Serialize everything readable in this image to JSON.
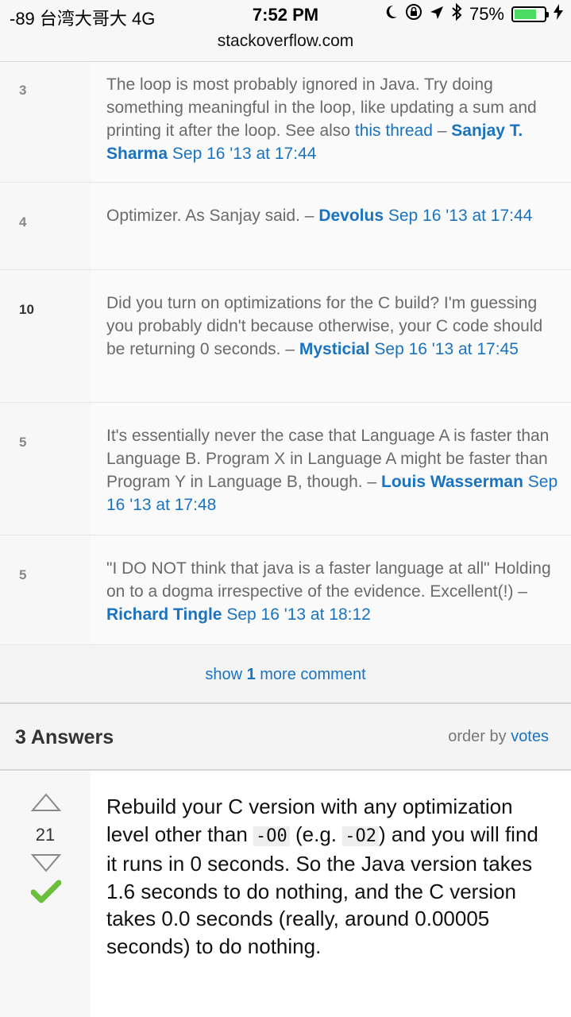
{
  "status_bar": {
    "carrier": "-89 台湾大哥大  4G",
    "time": "7:52 PM",
    "battery": "75%",
    "battery_level": 0.75,
    "icons": [
      "moon-icon",
      "rotation-lock-icon",
      "location-icon",
      "bluetooth-icon",
      "battery-icon",
      "charging-icon"
    ],
    "url": "stackoverflow.com"
  },
  "comments": [
    {
      "score": "3",
      "text": "The loop is most probably ignored in Java. Try doing something meaningful in the loop, like updating a sum and printing it after the loop. See also ",
      "link": "this thread",
      "sep": " – ",
      "user": "Sanjay T. Sharma",
      "date": "Sep 16 '13 at 17:44"
    },
    {
      "score": "4",
      "text": "Optimizer. As Sanjay said.",
      "sep": " – ",
      "user": "Devolus",
      "date": "Sep 16 '13 at 17:44"
    },
    {
      "score": "10",
      "text": "Did you turn on optimizations for the C build? I'm guessing you probably didn't because otherwise, your C code should be returning 0 seconds.",
      "sep": " – ",
      "user": "Mysticial",
      "date": "Sep 16 '13 at 17:45"
    },
    {
      "score": "5",
      "text": "It's essentially never the case that Language A is faster than Language B. Program X in Language A might be faster than Program Y in Language B, though.",
      "sep": " – ",
      "user": "Louis Wasserman",
      "date": "Sep 16 '13 at 17:48"
    },
    {
      "score": "5",
      "text": "\"I DO NOT think that java is a faster language at all\" Holding on to a dogma irrespective of the evidence. Excellent(!)",
      "sep": " – ",
      "user": "Richard Tingle",
      "date": "Sep 16 '13 at 18:12"
    }
  ],
  "show_more": {
    "prefix": "show ",
    "count": "1",
    "suffix": " more comment"
  },
  "answers_header": {
    "title": "3 Answers",
    "order_label": "order by ",
    "order_value": "votes"
  },
  "answer": {
    "votes": "21",
    "accepted": true,
    "parts": [
      {
        "type": "text",
        "value": "Rebuild your C version with any optimization level other than "
      },
      {
        "type": "code",
        "value": "-O0"
      },
      {
        "type": "text",
        "value": " (e.g. "
      },
      {
        "type": "code",
        "value": "-O2"
      },
      {
        "type": "text",
        "value": ") and you will find it runs in 0 seconds. So the Java version takes 1.6 seconds to do nothing, and the C version takes 0.0 seconds (really, around 0.00005 seconds) to do nothing."
      }
    ]
  },
  "colors": {
    "link": "#1a73c0",
    "accept": "#6cbf3b",
    "battery_fill": "#4cd964"
  }
}
